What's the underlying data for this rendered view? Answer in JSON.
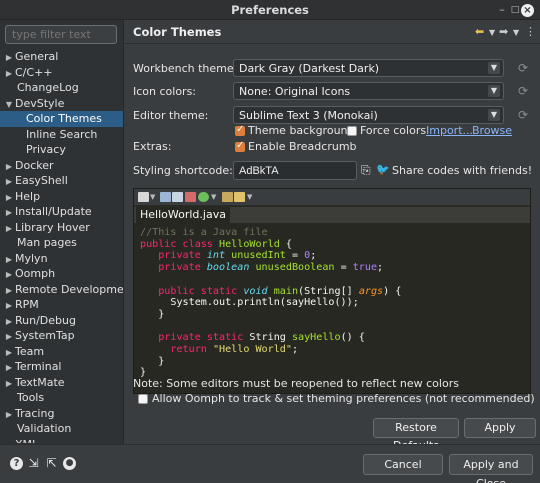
{
  "window": {
    "title": "Preferences"
  },
  "filter": {
    "placeholder": "type filter text"
  },
  "tree": [
    {
      "label": "General",
      "level": 0,
      "arrow": "▶"
    },
    {
      "label": "C/C++",
      "level": 0,
      "arrow": "▶"
    },
    {
      "label": "ChangeLog",
      "level": 0,
      "arrow": ""
    },
    {
      "label": "DevStyle",
      "level": 0,
      "arrow": "▼"
    },
    {
      "label": "Color Themes",
      "level": 1,
      "arrow": "",
      "selected": true
    },
    {
      "label": "Inline Search",
      "level": 1,
      "arrow": ""
    },
    {
      "label": "Privacy",
      "level": 1,
      "arrow": ""
    },
    {
      "label": "Docker",
      "level": 0,
      "arrow": "▶"
    },
    {
      "label": "EasyShell",
      "level": 0,
      "arrow": "▶"
    },
    {
      "label": "Help",
      "level": 0,
      "arrow": "▶"
    },
    {
      "label": "Install/Update",
      "level": 0,
      "arrow": "▶"
    },
    {
      "label": "Library Hover",
      "level": 0,
      "arrow": "▶"
    },
    {
      "label": "Man pages",
      "level": 0,
      "arrow": ""
    },
    {
      "label": "Mylyn",
      "level": 0,
      "arrow": "▶"
    },
    {
      "label": "Oomph",
      "level": 0,
      "arrow": "▶"
    },
    {
      "label": "Remote Development",
      "level": 0,
      "arrow": "▶"
    },
    {
      "label": "RPM",
      "level": 0,
      "arrow": "▶"
    },
    {
      "label": "Run/Debug",
      "level": 0,
      "arrow": "▶"
    },
    {
      "label": "SystemTap",
      "level": 0,
      "arrow": "▶"
    },
    {
      "label": "Team",
      "level": 0,
      "arrow": "▶"
    },
    {
      "label": "Terminal",
      "level": 0,
      "arrow": "▶"
    },
    {
      "label": "TextMate",
      "level": 0,
      "arrow": "▶"
    },
    {
      "label": "Tools",
      "level": 0,
      "arrow": ""
    },
    {
      "label": "Tracing",
      "level": 0,
      "arrow": "▶"
    },
    {
      "label": "Validation",
      "level": 0,
      "arrow": ""
    },
    {
      "label": "XML",
      "level": 0,
      "arrow": "▶"
    }
  ],
  "page": {
    "title": "Color Themes",
    "workbench_label": "Workbench theme:",
    "workbench_value": "Dark Gray (Darkest Dark)",
    "icon_label": "Icon colors:",
    "icon_value": "None: Original Icons",
    "editor_label": "Editor theme:",
    "editor_value": "Sublime Text 3 (Monokai)",
    "theme_background": "Theme background",
    "force_colors": "Force colors",
    "import_link": "Import...",
    "browse_link": "Browse",
    "extras_label": "Extras:",
    "enable_breadcrumb": "Enable Breadcrumb",
    "shortcode_label": "Styling shortcode:",
    "shortcode_value": "AdBkTA",
    "share_text": "Share codes with friends!",
    "tab_label": "HelloWorld.java",
    "note": "Note: Some editors must be reopened to reflect new colors",
    "allow_oomph": "Allow Oomph to track & set theming preferences (not recommended)",
    "restore_defaults": "Restore Defaults",
    "apply": "Apply"
  },
  "code": [
    "//This is a Java file",
    "public class HelloWorld {",
    "   private int unusedInt = 0;",
    "   private boolean unusedBoolean = true;",
    "",
    "   public static void main(String[] args) {",
    "     System.out.println(sayHello());",
    "   }",
    "",
    "   private static String sayHello() {",
    "     return \"Hello World\";",
    "   }",
    "}"
  ],
  "footer": {
    "cancel": "Cancel",
    "apply_close": "Apply and Close"
  },
  "colors": {
    "selection": "#2c5d87",
    "accent": "#e07d3a",
    "link": "#8ab4f8",
    "editor_bg": "#272822"
  }
}
